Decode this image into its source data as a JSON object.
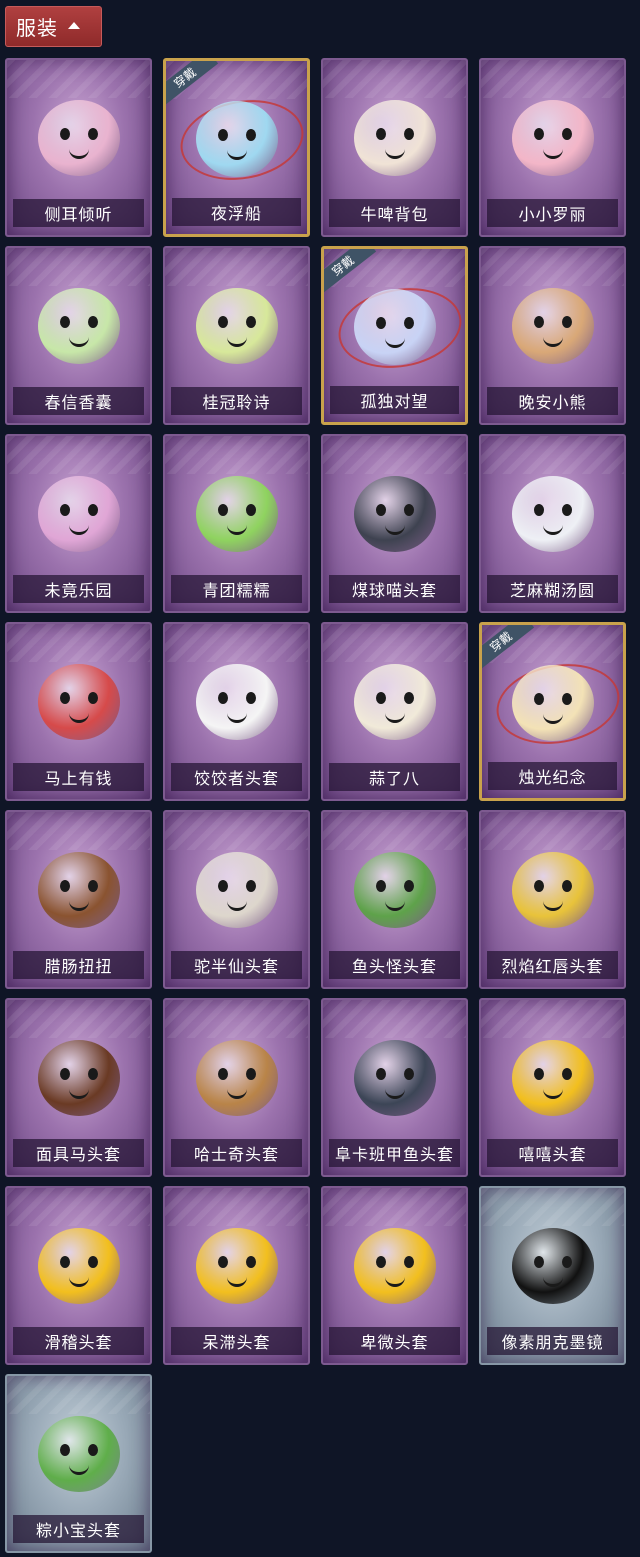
{
  "header": {
    "title": "服装",
    "toggle_icon": "chevron-up-icon"
  },
  "badge_text": "穿戴",
  "items": [
    {
      "name": "侧耳倾听",
      "art": "flower-wreath-icon",
      "color": "#e9b3cf",
      "style": "purple",
      "equipped": false
    },
    {
      "name": "夜浮船",
      "art": "jellyfish-icon",
      "color": "#9fd8f0",
      "style": "purple",
      "equipped": true
    },
    {
      "name": "牛啤背包",
      "art": "cow-barrel-icon",
      "color": "#f0e3d6",
      "style": "purple",
      "equipped": false
    },
    {
      "name": "小小罗丽",
      "art": "doll-icon",
      "color": "#f3b6c8",
      "style": "purple",
      "equipped": false
    },
    {
      "name": "春信香囊",
      "art": "sachet-icon",
      "color": "#c7e7a8",
      "style": "purple",
      "equipped": false
    },
    {
      "name": "桂冠聆诗",
      "art": "fairy-charm-icon",
      "color": "#d7e89a",
      "style": "purple",
      "equipped": false
    },
    {
      "name": "孤独对望",
      "art": "angel-charm-icon",
      "color": "#c8d3f5",
      "style": "purple",
      "equipped": true
    },
    {
      "name": "晚安小熊",
      "art": "bear-charm-icon",
      "color": "#d9a877",
      "style": "purple",
      "equipped": false
    },
    {
      "name": "未竟乐园",
      "art": "girl-doll-icon",
      "color": "#e0a6d6",
      "style": "purple",
      "equipped": false
    },
    {
      "name": "青团糯糯",
      "art": "green-mochi-icon",
      "color": "#8fd35f",
      "style": "purple",
      "equipped": false
    },
    {
      "name": "煤球喵头套",
      "art": "black-cat-icon",
      "color": "#3e4250",
      "style": "purple",
      "equipped": false
    },
    {
      "name": "芝麻糊汤圆",
      "art": "dumpling-icon",
      "color": "#eef0f5",
      "style": "purple",
      "equipped": false
    },
    {
      "name": "马上有钱",
      "art": "red-horse-icon",
      "color": "#d64a4a",
      "style": "purple",
      "equipped": false
    },
    {
      "name": "饺饺者头套",
      "art": "cloud-dumpling-icon",
      "color": "#f5f5f5",
      "style": "purple",
      "equipped": false
    },
    {
      "name": "蒜了八",
      "art": "garlic-icon",
      "color": "#f1ead9",
      "style": "purple",
      "equipped": false
    },
    {
      "name": "烛光纪念",
      "art": "candle-icon",
      "color": "#f3e2b6",
      "style": "purple",
      "equipped": true
    },
    {
      "name": "腊肠扭扭",
      "art": "dachshund-icon",
      "color": "#8a5330",
      "style": "purple",
      "equipped": false
    },
    {
      "name": "驼半仙头套",
      "art": "raccoon-icon",
      "color": "#ddd6cc",
      "style": "purple",
      "equipped": false
    },
    {
      "name": "鱼头怪头套",
      "art": "fish-head-icon",
      "color": "#5ea24a",
      "style": "purple",
      "equipped": false
    },
    {
      "name": "烈焰红唇头套",
      "art": "yellow-mascot-icon",
      "color": "#e8c33a",
      "style": "purple",
      "equipped": false
    },
    {
      "name": "面具马头套",
      "art": "horse-mask-icon",
      "color": "#6a3a24",
      "style": "purple",
      "equipped": false
    },
    {
      "name": "哈士奇头套",
      "art": "husky-icon",
      "color": "#b98448",
      "style": "purple",
      "equipped": false
    },
    {
      "name": "阜卡班甲鱼头套",
      "art": "fish-icon",
      "color": "#3c4556",
      "style": "purple",
      "equipped": false
    },
    {
      "name": "嘻嘻头套",
      "art": "grin-emoji-icon",
      "color": "#f2bf1e",
      "style": "purple",
      "equipped": false
    },
    {
      "name": "滑稽头套",
      "art": "smirk-emoji-icon",
      "color": "#f2bf1e",
      "style": "purple",
      "equipped": false
    },
    {
      "name": "呆滞头套",
      "art": "blank-emoji-icon",
      "color": "#f2bf1e",
      "style": "purple",
      "equipped": false
    },
    {
      "name": "卑微头套",
      "art": "shy-emoji-icon",
      "color": "#f2bf1e",
      "style": "purple",
      "equipped": false
    },
    {
      "name": "像素朋克墨镜",
      "art": "pixel-sunglasses-icon",
      "color": "#111111",
      "style": "grey",
      "equipped": false
    },
    {
      "name": "粽小宝头套",
      "art": "zongzi-icon",
      "color": "#5fae4a",
      "style": "grey",
      "equipped": false
    }
  ]
}
